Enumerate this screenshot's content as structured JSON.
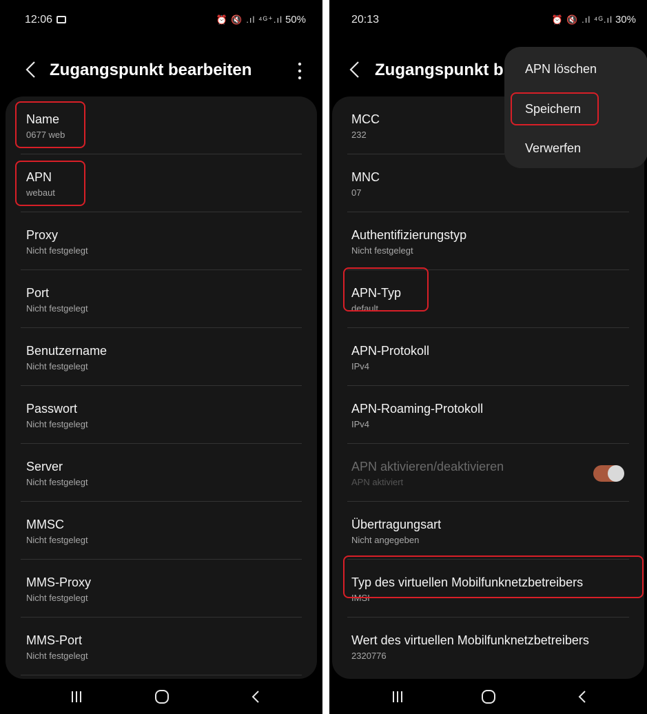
{
  "left_screen": {
    "status": {
      "time": "12:06",
      "icons": "⏰ 🔇 .ıl ⁴ᴳ⁺.ıl",
      "battery": "50%"
    },
    "title": "Zugangspunkt bearbeiten",
    "rows": [
      {
        "title": "Name",
        "value": "0677 web"
      },
      {
        "title": "APN",
        "value": "webaut"
      },
      {
        "title": "Proxy",
        "value": "Nicht festgelegt"
      },
      {
        "title": "Port",
        "value": "Nicht festgelegt"
      },
      {
        "title": "Benutzername",
        "value": "Nicht festgelegt"
      },
      {
        "title": "Passwort",
        "value": "Nicht festgelegt"
      },
      {
        "title": "Server",
        "value": "Nicht festgelegt"
      },
      {
        "title": "MMSC",
        "value": "Nicht festgelegt"
      },
      {
        "title": "MMS-Proxy",
        "value": "Nicht festgelegt"
      },
      {
        "title": "MMS-Port",
        "value": "Nicht festgelegt"
      }
    ]
  },
  "right_screen": {
    "status": {
      "time": "20:13",
      "icons": "⏰ 🔇 .ıl ⁴ᴳ.ıl",
      "battery": "30%"
    },
    "title": "Zugangspunkt b",
    "rows": [
      {
        "title": "MCC",
        "value": "232"
      },
      {
        "title": "MNC",
        "value": "07"
      },
      {
        "title": "Authentifizierungstyp",
        "value": "Nicht festgelegt"
      },
      {
        "title": "APN-Typ",
        "value": "default"
      },
      {
        "title": "APN-Protokoll",
        "value": "IPv4"
      },
      {
        "title": "APN-Roaming-Protokoll",
        "value": "IPv4"
      },
      {
        "title": "APN aktivieren/deaktivieren",
        "value": "APN aktiviert",
        "toggle_on": true
      },
      {
        "title": "Übertragungsart",
        "value": "Nicht angegeben"
      },
      {
        "title": "Typ des virtuellen Mobilfunknetzbetreibers",
        "value": "IMSI"
      },
      {
        "title": "Wert des virtuellen Mobilfunknetzbetreibers",
        "value": "2320776"
      }
    ],
    "menu": [
      "APN löschen",
      "Speichern",
      "Verwerfen"
    ]
  },
  "colors": {
    "highlight": "#d81f27",
    "card": "#171717",
    "toggle_on": "#a9583d"
  }
}
